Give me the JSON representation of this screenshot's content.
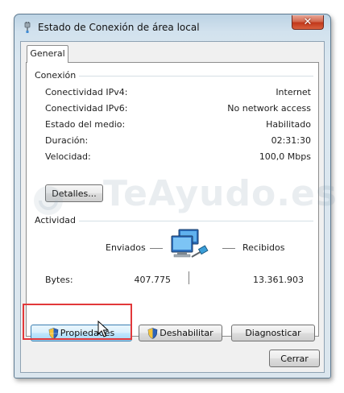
{
  "window": {
    "title": "Estado de Conexión de área local",
    "close_label": "✕"
  },
  "tabs": [
    {
      "label": "General",
      "selected": true
    }
  ],
  "connection": {
    "heading": "Conexión",
    "rows": [
      {
        "label": "Conectividad IPv4:",
        "value": "Internet"
      },
      {
        "label": "Conectividad IPv6:",
        "value": "No network access"
      },
      {
        "label": "Estado del medio:",
        "value": "Habilitado"
      },
      {
        "label": "Duración:",
        "value": "02:31:30"
      },
      {
        "label": "Velocidad:",
        "value": "100,0 Mbps"
      }
    ],
    "details_button": "Detalles..."
  },
  "activity": {
    "heading": "Actividad",
    "sent_label": "Enviados",
    "received_label": "Recibidos",
    "bytes_label": "Bytes:",
    "bytes_sent": "407.775",
    "bytes_received": "13.361.903"
  },
  "actions": {
    "properties": "Propiedades",
    "disable": "Deshabilitar",
    "diagnose": "Diagnosticar"
  },
  "footer": {
    "close": "Cerrar"
  },
  "watermark": {
    "text": "TeAyudo.es"
  },
  "icons": {
    "title": "network-plug-icon",
    "activity": "network-computers-icon",
    "uac": "shield-icon",
    "cursor": "mouse-pointer-icon"
  },
  "colors": {
    "highlight": "#e2383a",
    "close_button": "#c2381a",
    "hover_button": "#bee6fd"
  }
}
